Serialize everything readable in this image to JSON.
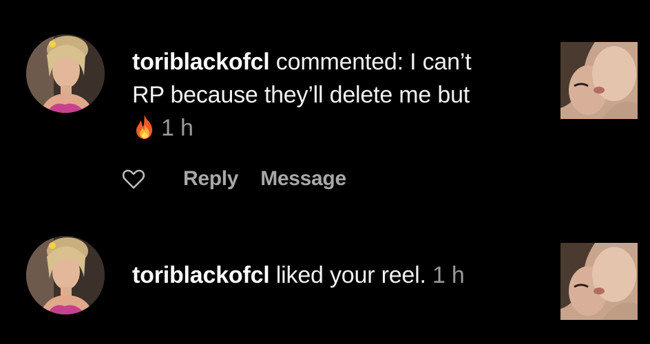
{
  "notifications": [
    {
      "username": "toriblackofcl",
      "text_line1": " commented: I can’t",
      "text_line2": "RP because they’ll delete me but",
      "emoji_icon": "fire-icon",
      "time": "1 h",
      "actions": {
        "like_icon": "heart-outline-icon",
        "reply_label": "Reply",
        "message_label": "Message"
      }
    },
    {
      "username": "toriblackofcl",
      "text": " liked your reel.",
      "time": "1 h"
    }
  ],
  "colors": {
    "background": "#000000",
    "text": "#ffffff",
    "secondary_text": "#9a9a9a",
    "action_text": "#a8a8a8"
  }
}
